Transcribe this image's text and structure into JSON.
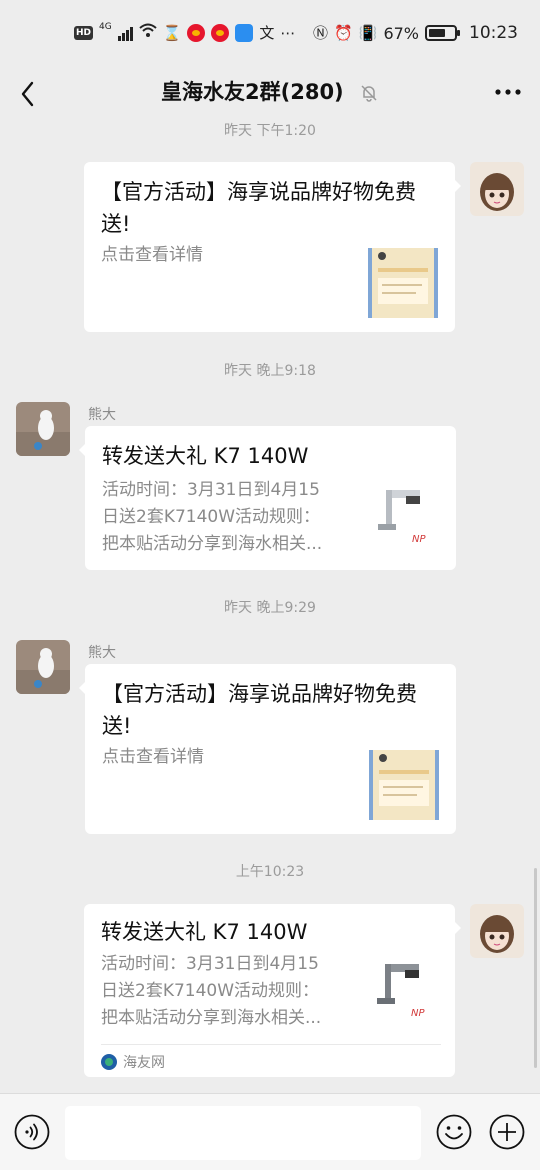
{
  "status_bar": {
    "network": "4G",
    "hd": "HD",
    "battery_percent": "67%",
    "battery_level": 0.67,
    "time": "10:23"
  },
  "header": {
    "title": "皇海水友2群(280)",
    "icons": [
      "back-icon",
      "mute-bell-icon",
      "more-icon"
    ]
  },
  "messages": [
    {
      "timestamp": "昨天 下午1:20",
      "side": "right",
      "title": "【官方活动】海享说品牌好物免费送!",
      "desc": "点击查看详情"
    },
    {
      "timestamp": "昨天 晚上9:18",
      "side": "left",
      "sender": "熊大",
      "title": "转发送大礼 K7 140W",
      "desc_lines": [
        "活动时间：3月31日到4月15",
        "日送2套K7140W活动规则：",
        "把本贴活动分享到海水相关..."
      ]
    },
    {
      "timestamp": "昨天 晚上9:29",
      "side": "left",
      "sender": "熊大",
      "title": "【官方活动】海享说品牌好物免费送!",
      "desc": "点击查看详情"
    },
    {
      "timestamp": "上午10:23",
      "side": "right",
      "title": "转发送大礼 K7 140W",
      "desc_lines": [
        "活动时间：3月31日到4月15",
        "日送2套K7140W活动规则：",
        "把本贴活动分享到海水相关..."
      ],
      "source": "海友网"
    }
  ],
  "input_bar": {
    "placeholder": "",
    "icons": [
      "voice-icon",
      "emoji-icon",
      "plus-icon"
    ]
  }
}
